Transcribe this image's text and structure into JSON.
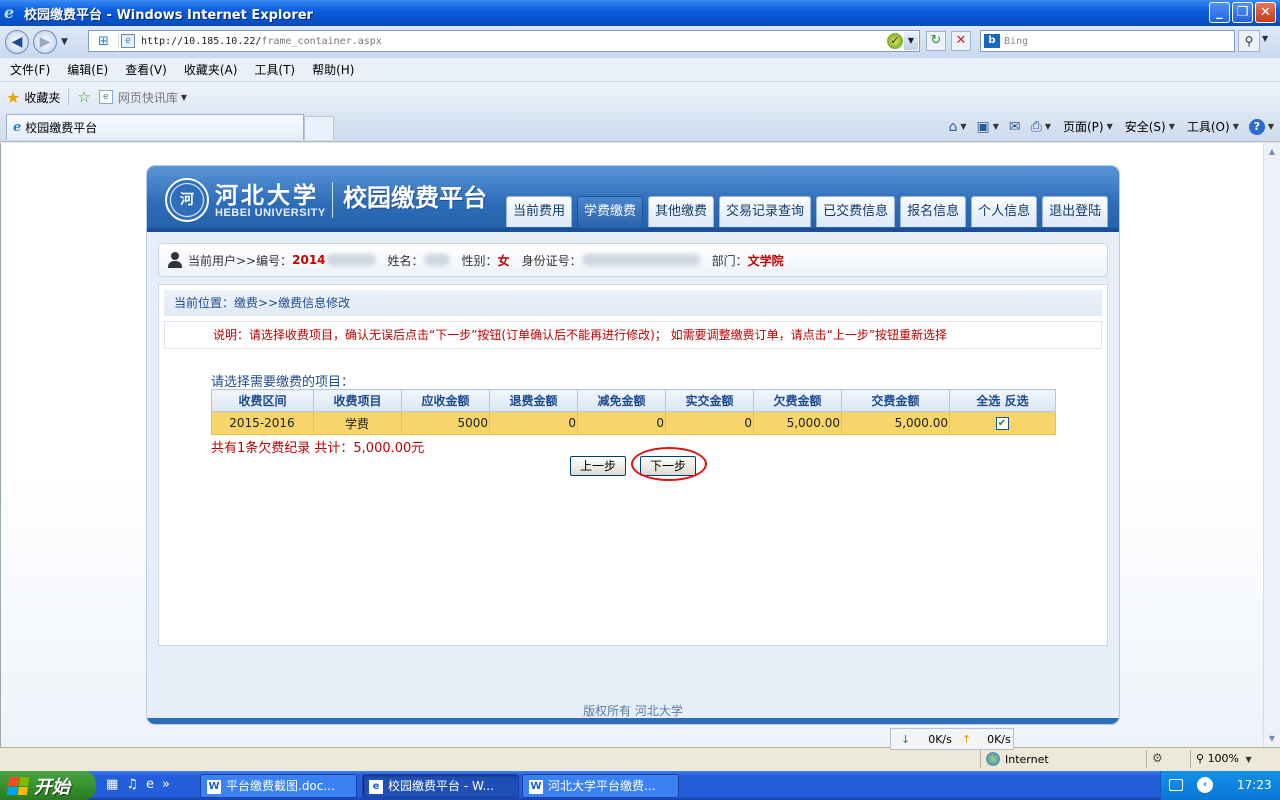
{
  "window": {
    "title": "校园缴费平台 - Windows Internet Explorer"
  },
  "addressbar": {
    "url_host": "http://10.185.10.22/",
    "url_path": "frame_container.aspx",
    "search_placeholder": "Bing"
  },
  "menubar": {
    "items": [
      "文件(F)",
      "编辑(E)",
      "查看(V)",
      "收藏夹(A)",
      "工具(T)",
      "帮助(H)"
    ]
  },
  "favbar": {
    "favorites_label": "收藏夹",
    "webslice_label": "网页快讯库"
  },
  "tabbar": {
    "active_tab": "校园缴费平台",
    "cmd_page": "页面(P)",
    "cmd_safety": "安全(S)",
    "cmd_tools": "工具(O)"
  },
  "site": {
    "university_cn": "河北大学",
    "university_en": "HEBEI UNIVERSITY",
    "platform_title": "校园缴费平台",
    "nav": [
      "当前费用",
      "学费缴费",
      "其他缴费",
      "交易记录查询",
      "已交费信息",
      "报名信息",
      "个人信息",
      "退出登陆"
    ],
    "active_nav": "学费缴费",
    "footer": "版权所有 河北大学"
  },
  "user": {
    "prefix": "当前用户>>编号：",
    "id": "2014",
    "name_label": "姓名：",
    "gender_label": "性别：",
    "gender": "女",
    "idcard_label": "身份证号：",
    "dept_label": "部门：",
    "dept": "文学院"
  },
  "page": {
    "location": "当前位置：缴费>>缴费信息修改",
    "notice": "说明：请选择收费项目，确认无误后点击“下一步”按钮(订单确认后不能再进行修改)； 如需要调整缴费订单，请点击“上一步”按钮重新选择",
    "select_prompt": "请选择需要缴费的项目：",
    "summary": "共有1条欠费纪录  共计：5,000.00元",
    "prev_button": "上一步",
    "next_button": "下一步"
  },
  "fees_table": {
    "headers": [
      "收费区间",
      "收费项目",
      "应收金额",
      "退费金额",
      "减免金额",
      "实交金额",
      "欠费金额",
      "交费金额",
      "全选  反选"
    ],
    "rows": [
      {
        "period": "2015-2016",
        "item": "学费",
        "receivable": "5000",
        "refund": "0",
        "waived": "0",
        "paid": "0",
        "owed": "5,000.00",
        "payment": "5,000.00",
        "selected": true
      }
    ]
  },
  "statusbar": {
    "down_speed": "0K/s",
    "up_speed": "0K/s",
    "zone": "Internet",
    "zoom": "100%"
  },
  "taskbar": {
    "start_label": "开始",
    "tasks": [
      "平台缴费截图.doc...",
      "校园缴费平台 - W...",
      "河北大学平台缴费..."
    ],
    "clock": "17:23"
  },
  "colors": {
    "header_blue": "#2e6db8",
    "highlight_row": "#f7d56a",
    "alert_red": "#c00000"
  }
}
